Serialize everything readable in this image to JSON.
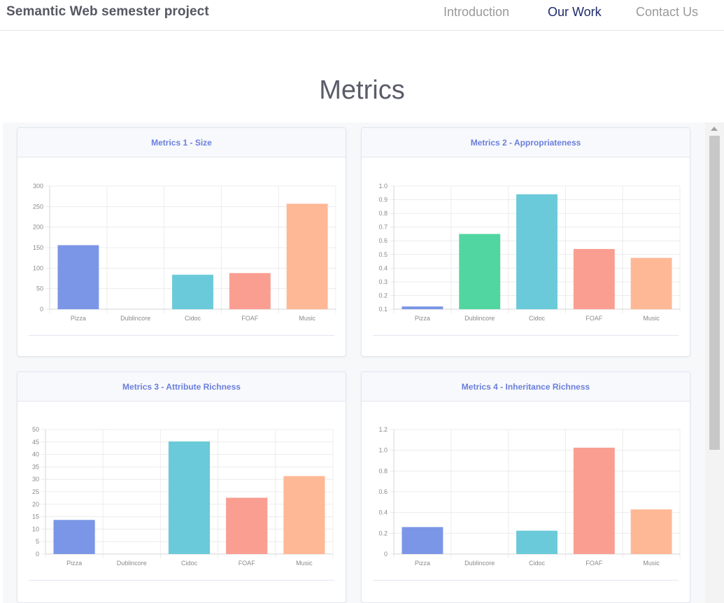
{
  "nav": {
    "brand": "Semantic Web semester project",
    "links": [
      "Introduction",
      "Our Work",
      "Contact Us"
    ],
    "active": "Our Work"
  },
  "section": {
    "title": "Metrics"
  },
  "colors": {
    "bar_colors": [
      "#7b96e6",
      "#52d6a1",
      "#6acad9",
      "#f99e91",
      "#ffb896"
    ],
    "title_color": "#6a7fdb",
    "active_nav": "#1f2a6b"
  },
  "chart_data": [
    {
      "type": "bar",
      "title": "Metrics 1 - Size",
      "categories": [
        "Pizza",
        "Dublincore",
        "Cidoc",
        "FOAF",
        "Music"
      ],
      "values": [
        156,
        0,
        84,
        88,
        257
      ],
      "ylim": [
        0,
        300
      ],
      "yticks": [
        "0",
        "50",
        "100",
        "150",
        "200",
        "250",
        "300"
      ],
      "grid": true
    },
    {
      "type": "bar",
      "title": "Metrics 2 - Appropriateness",
      "categories": [
        "Pizza",
        "Dublincore",
        "Cidoc",
        "FOAF",
        "Music"
      ],
      "values": [
        0.12,
        0.65,
        0.94,
        0.54,
        0.475
      ],
      "ylim": [
        0.1,
        1.0
      ],
      "yticks": [
        "0.1",
        "0.2",
        "0.3",
        "0.4",
        "0.5",
        "0.6",
        "0.7",
        "0.8",
        "0.9",
        "1.0"
      ],
      "grid": true
    },
    {
      "type": "bar",
      "title": "Metrics 3 - Attribute Richness",
      "categories": [
        "Pizza",
        "Dublincore",
        "Cidoc",
        "FOAF",
        "Music"
      ],
      "values": [
        13.7,
        0,
        45.2,
        22.6,
        31.3
      ],
      "ylim": [
        0,
        50
      ],
      "yticks": [
        "0",
        "5",
        "10",
        "15",
        "20",
        "25",
        "30",
        "35",
        "40",
        "45",
        "50"
      ],
      "grid": true
    },
    {
      "type": "bar",
      "title": "Metrics 4 - Inheritance Richness",
      "categories": [
        "Pizza",
        "Dublincore",
        "Cidoc",
        "FOAF",
        "Music"
      ],
      "values": [
        0.26,
        0,
        0.225,
        1.025,
        0.43
      ],
      "ylim": [
        0,
        1.2
      ],
      "yticks": [
        "0",
        "0.2",
        "0.4",
        "0.6",
        "0.8",
        "1.0",
        "1.2"
      ],
      "grid": true
    }
  ]
}
